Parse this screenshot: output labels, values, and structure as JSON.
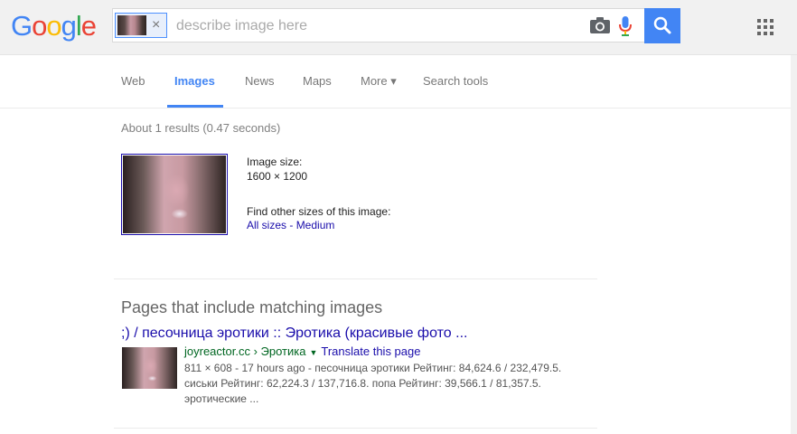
{
  "logo": {
    "letters": [
      {
        "char": "G",
        "color": "#4285f4"
      },
      {
        "char": "o",
        "color": "#ea4335"
      },
      {
        "char": "o",
        "color": "#fbbc05"
      },
      {
        "char": "g",
        "color": "#4285f4"
      },
      {
        "char": "l",
        "color": "#34a853"
      },
      {
        "char": "e",
        "color": "#ea4335"
      }
    ]
  },
  "search": {
    "placeholder": "describe image here",
    "value": "",
    "chip_close": "×",
    "icons": {
      "camera": "camera-icon",
      "mic": "mic-icon",
      "search": "search-icon",
      "apps": "apps-grid-icon"
    }
  },
  "nav": {
    "tabs": [
      {
        "id": "web",
        "label": "Web",
        "active": false
      },
      {
        "id": "images",
        "label": "Images",
        "active": true
      },
      {
        "id": "news",
        "label": "News",
        "active": false
      },
      {
        "id": "maps",
        "label": "Maps",
        "active": false
      },
      {
        "id": "more",
        "label": "More ▾",
        "active": false
      },
      {
        "id": "search_tools",
        "label": "Search tools",
        "active": false
      }
    ]
  },
  "results": {
    "stats": "About 1 results (0.47 seconds)",
    "image_size_label": "Image size:",
    "image_size_value": "1600 × 1200",
    "find_other_label": "Find other sizes of this image:",
    "all_sizes": "All sizes",
    "separator": " - ",
    "medium": "Medium"
  },
  "pages": {
    "heading": "Pages that include matching images",
    "items": [
      {
        "title": ";) / песочница эротики :: Эротика (красивые фото ...",
        "url": "joyreactor.cc › Эротика",
        "arrow": "▼",
        "translate": "Translate this page",
        "snippet": "811 × 608 - 17 hours ago - песочница эротики Рейтинг: 84,624.6 / 232,479.5. сиськи Рейтинг: 62,224.3 / 137,716.8. попа Рейтинг: 39,566.1 / 81,357.5. эротические ..."
      }
    ]
  },
  "colors": {
    "brand_blue": "#4285f4",
    "link": "#1a0dab",
    "url_green": "#006621",
    "muted": "#808080"
  }
}
